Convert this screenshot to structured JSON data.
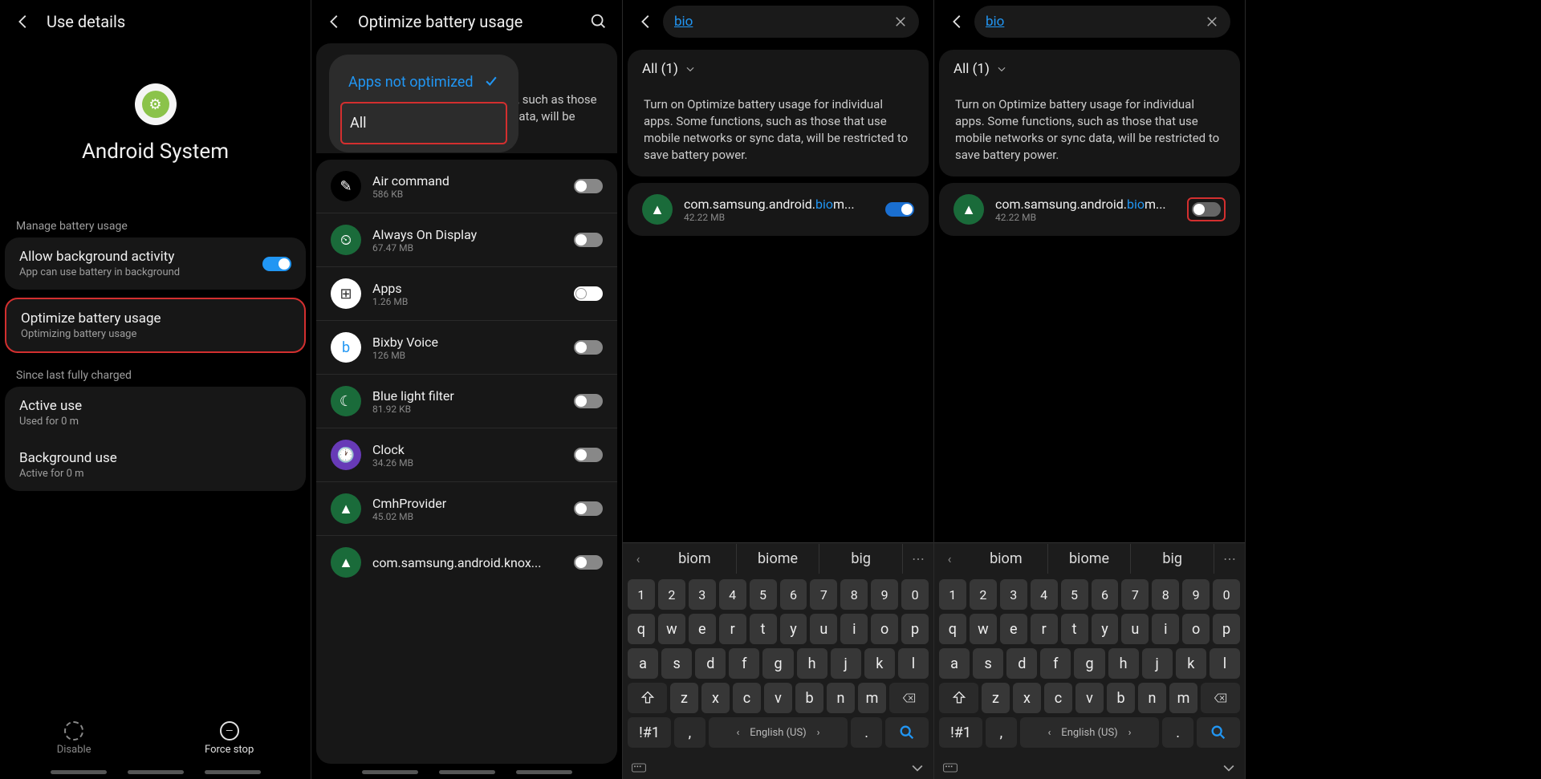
{
  "pane1": {
    "title": "Use details",
    "app_name": "Android System",
    "section1": "Manage battery usage",
    "allow_bg": {
      "title": "Allow background activity",
      "sub": "App can use battery in background"
    },
    "optimize": {
      "title": "Optimize battery usage",
      "sub": "Optimizing battery usage"
    },
    "section2": "Since last fully charged",
    "active": {
      "title": "Active use",
      "sub": "Used for 0 m"
    },
    "background": {
      "title": "Background use",
      "sub": "Active for 0 m"
    },
    "footer": {
      "disable": "Disable",
      "force_stop": "Force stop"
    }
  },
  "pane2": {
    "title": "Optimize battery usage",
    "dropdown": {
      "selected": "Apps not optimized",
      "option_all": "All"
    },
    "desc_suffix": "or individual apps. Some functions, such as those that use mobile networks or sync data, will be restricted to save battery power.",
    "apps": [
      {
        "name": "Air command",
        "size": "586 KB",
        "icon_bg": "#000",
        "icon_fg": "#fff",
        "glyph": "✎"
      },
      {
        "name": "Always On Display",
        "size": "67.47 MB",
        "icon_bg": "#1a6b3a",
        "icon_fg": "#fff",
        "glyph": "⏲"
      },
      {
        "name": "Apps",
        "size": "1.26 MB",
        "icon_bg": "#fff",
        "icon_fg": "#333",
        "glyph": "⊞",
        "toggle_on": true
      },
      {
        "name": "Bixby Voice",
        "size": "126 MB",
        "icon_bg": "#fff",
        "icon_fg": "#2196f3",
        "glyph": "b"
      },
      {
        "name": "Blue light filter",
        "size": "81.92 KB",
        "icon_bg": "#1a6b3a",
        "icon_fg": "#fff",
        "glyph": "☾"
      },
      {
        "name": "Clock",
        "size": "34.26 MB",
        "icon_bg": "#673ab7",
        "icon_fg": "#fff",
        "glyph": "🕐"
      },
      {
        "name": "CmhProvider",
        "size": "45.02 MB",
        "icon_bg": "#1a6b3a",
        "icon_fg": "#fff",
        "glyph": "▲"
      },
      {
        "name": "com.samsung.android.knox...",
        "size": "",
        "icon_bg": "#1a6b3a",
        "icon_fg": "#fff",
        "glyph": "▲"
      }
    ]
  },
  "search": {
    "query": "bio",
    "filter": "All (1)",
    "desc": "Turn on Optimize battery usage for individual apps. Some functions, such as those that use mobile networks or sync data, will be restricted to save battery power.",
    "result_prefix": "com.samsung.android.",
    "result_match": "bio",
    "result_suffix": "m...",
    "result_size": "42.22 MB",
    "suggestions": [
      "biom",
      "biome",
      "big"
    ],
    "keyboard": {
      "numbers": [
        "1",
        "2",
        "3",
        "4",
        "5",
        "6",
        "7",
        "8",
        "9",
        "0"
      ],
      "row1": [
        "q",
        "w",
        "e",
        "r",
        "t",
        "y",
        "u",
        "i",
        "o",
        "p"
      ],
      "row2": [
        "a",
        "s",
        "d",
        "f",
        "g",
        "h",
        "j",
        "k",
        "l"
      ],
      "row3": [
        "z",
        "x",
        "c",
        "v",
        "b",
        "n",
        "m"
      ],
      "sym": "!#1",
      "comma": ",",
      "space": "English (US)",
      "period": "."
    }
  }
}
